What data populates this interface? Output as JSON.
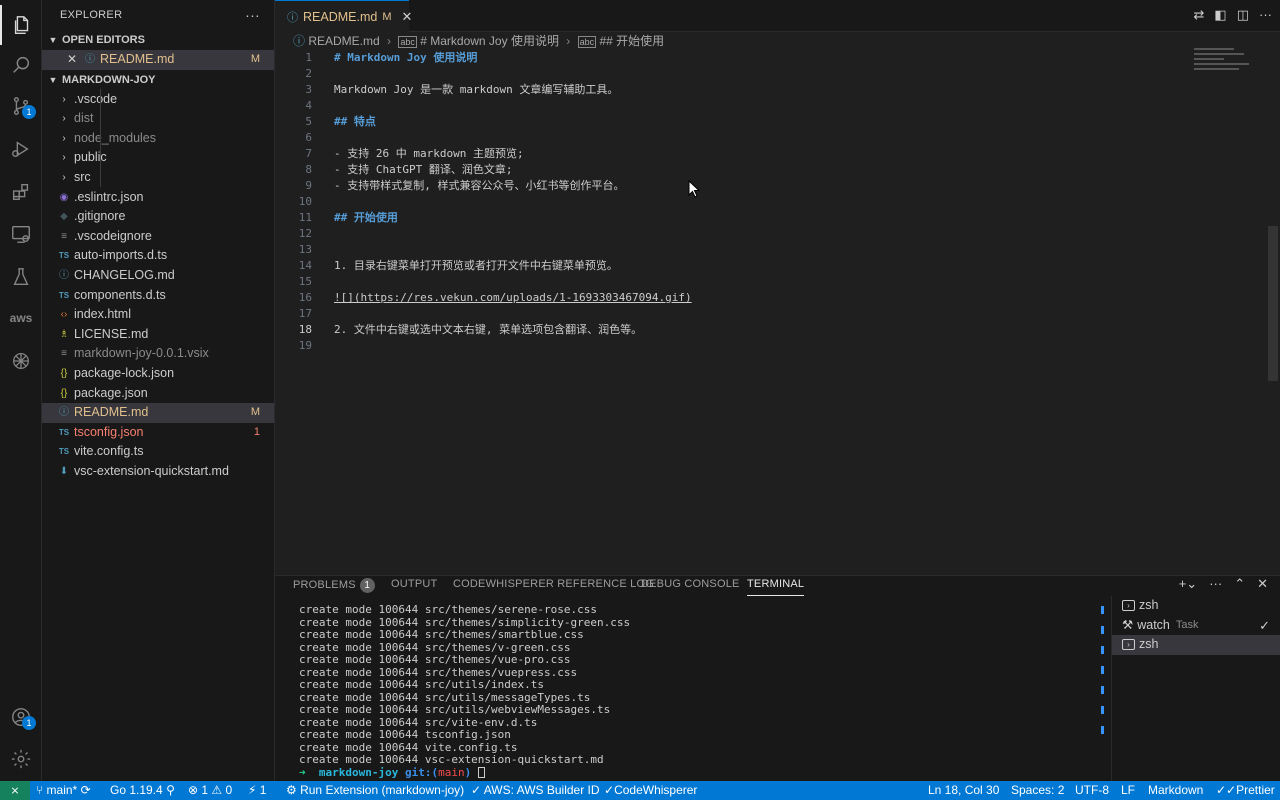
{
  "activity_bar": {
    "source_control_badge": "1",
    "accounts_badge": "1",
    "aws_label": "aws"
  },
  "sidebar": {
    "title": "EXPLORER",
    "open_editors": {
      "label": "OPEN EDITORS",
      "items": [
        {
          "name": "README.md",
          "decoration": "M"
        }
      ]
    },
    "project": {
      "label": "MARKDOWN-JOY",
      "items": [
        {
          "name": ".vscode",
          "type": "folder",
          "decoration": ""
        },
        {
          "name": "dist",
          "type": "folder",
          "decoration": "",
          "dim": true
        },
        {
          "name": "node_modules",
          "type": "folder",
          "decoration": "",
          "dim": true
        },
        {
          "name": "public",
          "type": "folder",
          "decoration": ""
        },
        {
          "name": "src",
          "type": "folder",
          "decoration": ""
        },
        {
          "name": ".eslintrc.json",
          "type": "eslint-icon",
          "decoration": ""
        },
        {
          "name": ".gitignore",
          "type": "git-icon",
          "decoration": ""
        },
        {
          "name": ".vscodeignore",
          "type": "file",
          "decoration": ""
        },
        {
          "name": "auto-imports.d.ts",
          "type": "ts-icon",
          "decoration": ""
        },
        {
          "name": "CHANGELOG.md",
          "type": "info-icon",
          "decoration": ""
        },
        {
          "name": "components.d.ts",
          "type": "ts-icon",
          "decoration": ""
        },
        {
          "name": "index.html",
          "type": "html-icon",
          "decoration": ""
        },
        {
          "name": "LICENSE.md",
          "type": "license-icon",
          "decoration": ""
        },
        {
          "name": "markdown-joy-0.0.1.vsix",
          "type": "file",
          "decoration": "",
          "dim": true
        },
        {
          "name": "package-lock.json",
          "type": "json-icon",
          "decoration": ""
        },
        {
          "name": "package.json",
          "type": "json-icon",
          "decoration": ""
        },
        {
          "name": "README.md",
          "type": "info-icon",
          "decoration": "M",
          "status": "modified",
          "selected": true
        },
        {
          "name": "tsconfig.json",
          "type": "ts-icon",
          "decoration": "1",
          "status": "error"
        },
        {
          "name": "vite.config.ts",
          "type": "ts-icon",
          "decoration": ""
        },
        {
          "name": "vsc-extension-quickstart.md",
          "type": "download-icon",
          "decoration": ""
        }
      ]
    }
  },
  "editor": {
    "tab": {
      "label": "README.md",
      "modified": "M"
    },
    "breadcrumb": [
      "README.md",
      "# Markdown Joy 使用说明",
      "## 开始使用"
    ],
    "current_line": 18,
    "lines": [
      {
        "n": "1",
        "text": "# Markdown Joy 使用说明",
        "kind": "heading"
      },
      {
        "n": "2",
        "text": "",
        "kind": "plain"
      },
      {
        "n": "3",
        "text": "Markdown Joy 是一款 markdown 文章编写辅助工具。",
        "kind": "plain"
      },
      {
        "n": "4",
        "text": "",
        "kind": "plain"
      },
      {
        "n": "5",
        "text": "## 特点",
        "kind": "heading"
      },
      {
        "n": "6",
        "text": "",
        "kind": "plain"
      },
      {
        "n": "7",
        "text": "- 支持 26 中 markdown 主题预览;",
        "kind": "bullet"
      },
      {
        "n": "8",
        "text": "- 支持 ChatGPT 翻译、润色文章;",
        "kind": "bullet"
      },
      {
        "n": "9",
        "text": "- 支持带样式复制, 样式兼容公众号、小红书等创作平台。",
        "kind": "bullet"
      },
      {
        "n": "10",
        "text": "",
        "kind": "plain"
      },
      {
        "n": "11",
        "text": "## 开始使用",
        "kind": "heading"
      },
      {
        "n": "12",
        "text": "",
        "kind": "plain"
      },
      {
        "n": "13",
        "text": "",
        "kind": "plain"
      },
      {
        "n": "14",
        "text": "1. 目录右键菜单打开预览或者打开文件中右键菜单预览。",
        "kind": "numbered"
      },
      {
        "n": "15",
        "text": "",
        "kind": "plain"
      },
      {
        "n": "16",
        "text": "![](https://res.vekun.com/uploads/1-1693303467094.gif)",
        "kind": "image"
      },
      {
        "n": "17",
        "text": "",
        "kind": "plain"
      },
      {
        "n": "18",
        "text": "2. 文件中右键或选中文本右键, 菜单选项包含翻译、润色等。",
        "kind": "numbered"
      },
      {
        "n": "19",
        "text": "",
        "kind": "plain"
      }
    ]
  },
  "panel": {
    "tabs": [
      {
        "label": "PROBLEMS",
        "badge": "1"
      },
      {
        "label": "OUTPUT"
      },
      {
        "label": "CODEWHISPERER REFERENCE LOG"
      },
      {
        "label": "DEBUG CONSOLE"
      },
      {
        "label": "TERMINAL",
        "active": true
      }
    ],
    "terminal_lines": [
      "create mode 100644 src/themes/serene-rose.css",
      "create mode 100644 src/themes/simplicity-green.css",
      "create mode 100644 src/themes/smartblue.css",
      "create mode 100644 src/themes/v-green.css",
      "create mode 100644 src/themes/vue-pro.css",
      "create mode 100644 src/themes/vuepress.css",
      "create mode 100644 src/utils/index.ts",
      "create mode 100644 src/utils/messageTypes.ts",
      "create mode 100644 src/utils/webviewMessages.ts",
      "create mode 100644 src/vite-env.d.ts",
      "create mode 100644 tsconfig.json",
      "create mode 100644 vite.config.ts",
      "create mode 100644 vsc-extension-quickstart.md"
    ],
    "prompt": {
      "arrow": "➜",
      "dir": "markdown-joy",
      "git": "git:(",
      "branch": "main",
      "close": ")"
    },
    "terminals": [
      {
        "name": "zsh",
        "task": "",
        "selected": false
      },
      {
        "name": "watch",
        "task": "Task",
        "selected": false,
        "check": true
      },
      {
        "name": "zsh",
        "task": "",
        "selected": true
      }
    ]
  },
  "statusbar": {
    "branch": "main*",
    "go": "Go 1.19.4",
    "problems_errors": "1",
    "problems_warnings": "0",
    "ports": "1",
    "run": "Run Extension (markdown-joy)",
    "aws": "AWS: AWS Builder ID",
    "codewhisperer": "CodeWhisperer",
    "position": "Ln 18, Col 30",
    "spaces": "Spaces: 2",
    "encoding": "UTF-8",
    "eol": "LF",
    "language": "Markdown",
    "prettier": "Prettier"
  }
}
